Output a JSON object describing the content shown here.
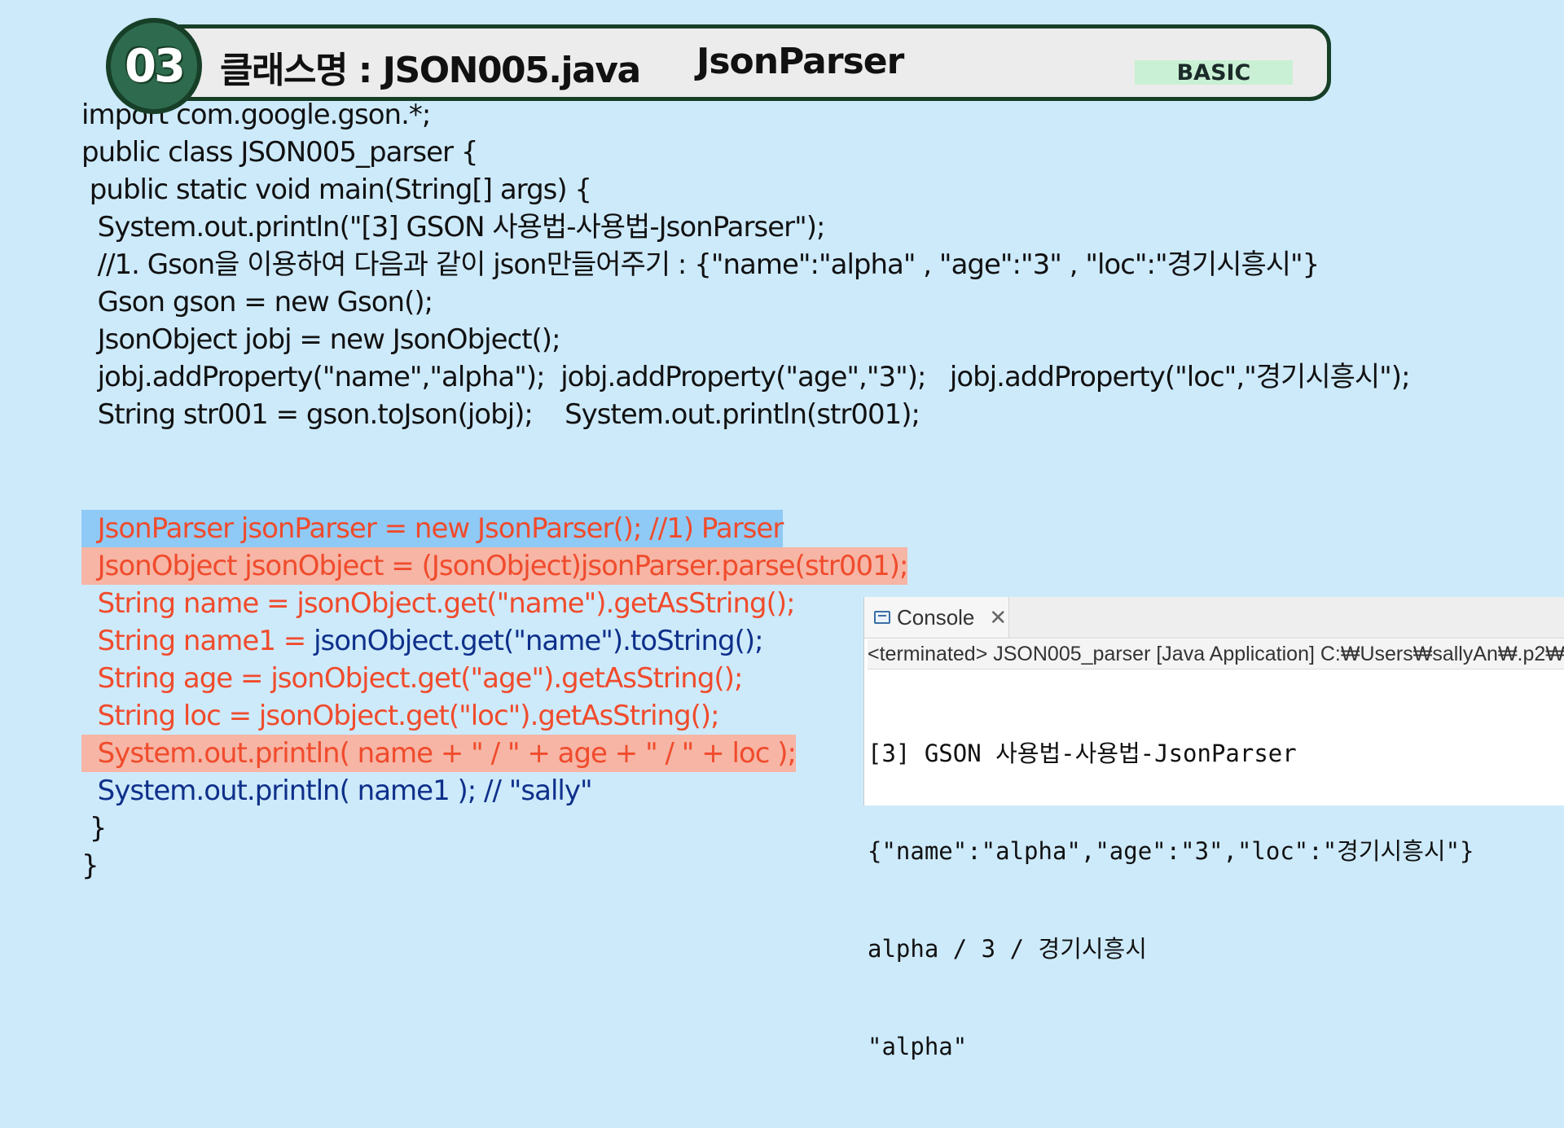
{
  "header": {
    "number": "03",
    "title": "클래스명 : JSON005.java",
    "subtitle": "JsonParser",
    "level": "BASIC"
  },
  "code": [
    "import com.google.gson.*;",
    "public class JSON005_parser {",
    " public static void main(String[] args) {",
    "  System.out.println(\"[3] GSON 사용법-사용법-JsonParser\");",
    "  //1. Gson을 이용하여 다음과 같이 json만들어주기 : {\"name\":\"alpha\" , \"age\":\"3\" , \"loc\":\"경기시흥시\"}",
    "  Gson gson = new Gson();",
    "  JsonObject jobj = new JsonObject();",
    "  jobj.addProperty(\"name\",\"alpha\");  jobj.addProperty(\"age\",\"3\");   jobj.addProperty(\"loc\",\"경기시흥시\");",
    "  String str001 = gson.toJson(jobj);    System.out.println(str001);"
  ],
  "parser_code": [
    {
      "text": "  JsonParser jsonParser = new JsonParser(); //1) Parser",
      "color": "red",
      "highlight": "blue"
    },
    {
      "text": "  JsonObject jsonObject = (JsonObject)jsonParser.parse(str001);",
      "color": "red",
      "highlight": "red"
    },
    {
      "text": "  String name = jsonObject.get(\"name\").getAsString();",
      "color": "red",
      "highlight": ""
    },
    {
      "segments": [
        "  String name1 = ",
        "jsonObject.get(\"name\").toString();"
      ],
      "color": "mixed",
      "highlight": ""
    },
    {
      "text": "  String age = jsonObject.get(\"age\").getAsString();",
      "color": "red",
      "highlight": ""
    },
    {
      "text": "  String loc = jsonObject.get(\"loc\").getAsString();",
      "color": "red",
      "highlight": ""
    },
    {
      "text": "  System.out.println( name + \" / \" + age + \" / \" + loc );",
      "color": "red",
      "highlight": "red"
    },
    {
      "text": "  System.out.println( name1 ); // \"sally\"",
      "color": "blue",
      "highlight": ""
    },
    {
      "text": " }",
      "color": "black",
      "highlight": ""
    },
    {
      "text": "}",
      "color": "black",
      "highlight": ""
    }
  ],
  "console": {
    "tab_label": "Console",
    "close_label": "✕",
    "status": "<terminated> JSON005_parser [Java Application] C:₩Users₩sallyAn₩.p2₩",
    "output": [
      "[3] GSON 사용법-사용법-JsonParser",
      "{\"name\":\"alpha\",\"age\":\"3\",\"loc\":\"경기시흥시\"}",
      "alpha / 3 / 경기시흥시",
      "\"alpha\""
    ]
  },
  "colors": {
    "background": "#cdeafb",
    "banner_border": "#173f27",
    "badge_fill": "#2e6b4e",
    "red_code": "#f04b2c",
    "blue_code": "#0e2f8a",
    "highlight_blue": "#8fcaf6",
    "highlight_red": "#f6b5a5",
    "level_bg": "#c9f0d4"
  }
}
